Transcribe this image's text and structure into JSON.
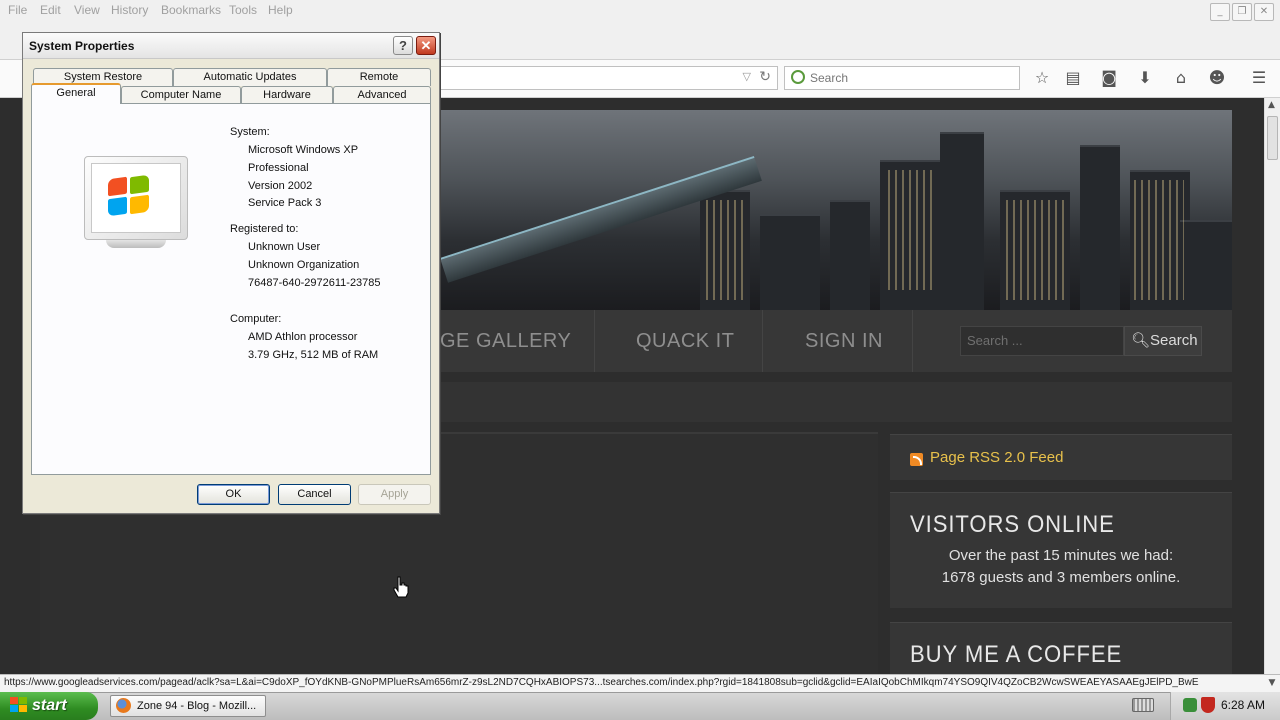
{
  "browser": {
    "menu": [
      "File",
      "Edit",
      "View",
      "History",
      "Bookmarks",
      "Tools",
      "Help"
    ],
    "window_controls": [
      "minimize",
      "restore",
      "close"
    ],
    "search_placeholder": "Search",
    "toolbar_icons": [
      "star-icon",
      "reading-list-icon",
      "pocket-icon",
      "download-icon",
      "home-icon",
      "chat-icon",
      "hamburger-menu-icon"
    ],
    "status_url": "https://www.googleadservices.com/pagead/aclk?sa=L&ai=C9doXP_fOYdKNB-GNoPMPlueRsAm656mrZ-z9sL2ND7CQHxABIOPS73...tsearches.com/index.php?rgid=1841808sub=gclid&gclid=EAIaIQobChMIkqm74YSO9QIV4QZoCB2WcwSWEAEYASAAEgJElPD_BwE"
  },
  "website": {
    "nav": [
      "GE GALLERY",
      "QUACK IT",
      "SIGN IN"
    ],
    "search_placeholder": "Search ...",
    "search_button": "Search",
    "rss_label": "Page RSS 2.0 Feed",
    "visitors_title": "VISITORS ONLINE",
    "visitors_line1": "Over the past 15 minutes we had:",
    "visitors_line2": "1678 guests and 3 members online.",
    "coffee_title": "BUY ME A COFFEE"
  },
  "dialog": {
    "title": "System Properties",
    "help": "?",
    "close": "✕",
    "tabs_row1": [
      "System Restore",
      "Automatic Updates",
      "Remote"
    ],
    "tabs_row2": [
      "General",
      "Computer Name",
      "Hardware",
      "Advanced"
    ],
    "selected_tab": "General",
    "system_label": "System:",
    "system_lines": [
      "Microsoft Windows XP",
      "Professional",
      "Version 2002",
      "Service Pack 3"
    ],
    "registered_label": "Registered to:",
    "registered_lines": [
      "Unknown User",
      "Unknown Organization",
      "76487-640-2972611-23785"
    ],
    "computer_label": "Computer:",
    "computer_lines": [
      "AMD Athlon processor",
      "3.79 GHz, 512 MB of RAM"
    ],
    "ok": "OK",
    "cancel": "Cancel",
    "apply": "Apply"
  },
  "taskbar": {
    "start": "start",
    "task_label": "Zone 94 - Blog - Mozill...",
    "clock": "6:28 AM"
  },
  "colors": {
    "xp_green": "#2f8c22",
    "dialog_bg": "#ece9d8",
    "rss_gold": "#e8c14b",
    "tab_highlight": "#e69a2e"
  }
}
